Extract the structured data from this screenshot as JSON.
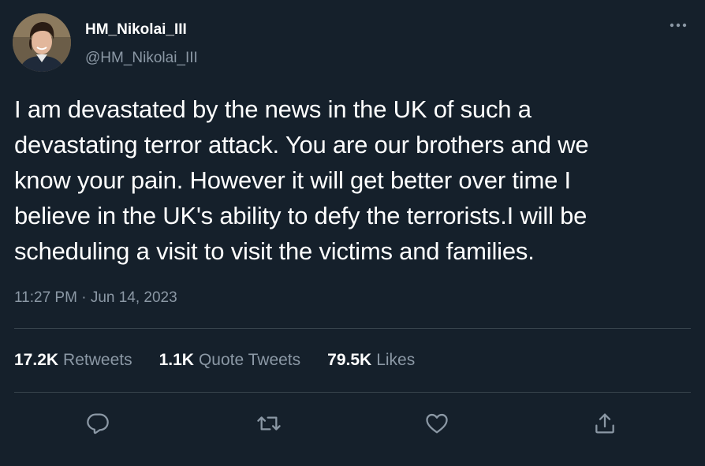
{
  "author": {
    "display_name": "HM_Nikolai_III",
    "handle": "@HM_Nikolai_III"
  },
  "tweet": {
    "text": "I am devastated by the news in the UK of such a\ndevastating terror attack. You are our brothers and we\nknow your pain. However it will get better over time I\nbelieve in the UK's ability to defy the terrorists.I will be\nscheduling a visit to visit the victims and families.",
    "time": "11:27 PM",
    "separator": "·",
    "date": "Jun 14, 2023"
  },
  "stats": {
    "retweets_count": "17.2K",
    "retweets_label": "Retweets",
    "quotes_count": "1.1K",
    "quotes_label": "Quote Tweets",
    "likes_count": "79.5K",
    "likes_label": "Likes"
  },
  "icons": {
    "more": "more-horizontal-icon",
    "reply": "reply-icon",
    "retweet": "retweet-icon",
    "like": "heart-icon",
    "share": "share-icon"
  },
  "colors": {
    "background": "#15202b",
    "primary_text": "#ffffff",
    "secondary_text": "#8b98a5",
    "divider": "#38444d"
  }
}
